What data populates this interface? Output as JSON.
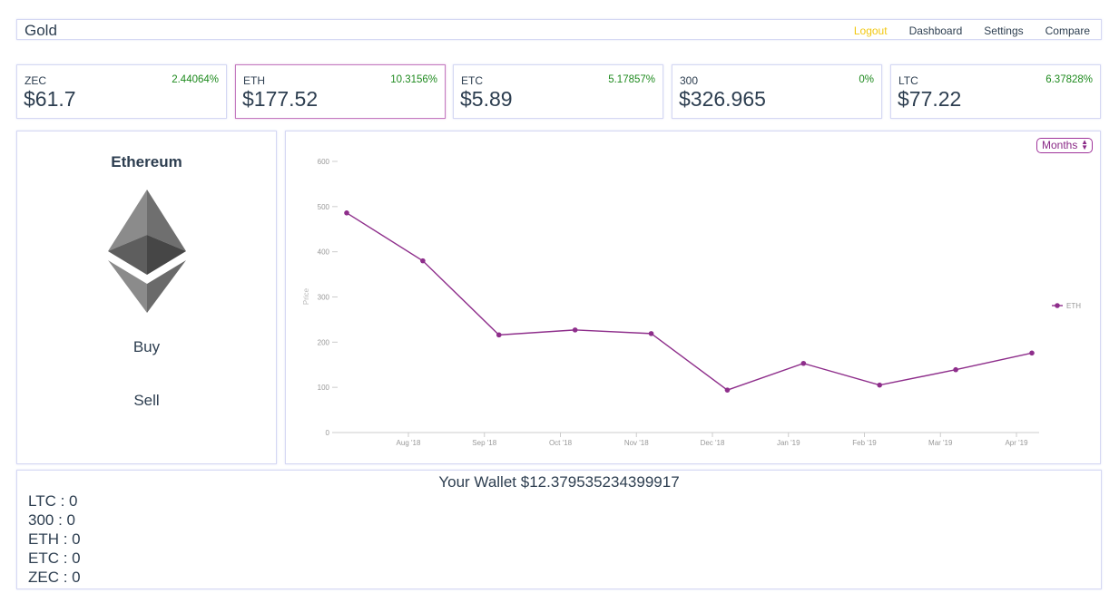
{
  "navbar": {
    "brand": "Gold",
    "links": [
      "Logout",
      "Dashboard",
      "Settings",
      "Compare"
    ]
  },
  "tickers": [
    {
      "symbol": "ZEC",
      "change": "2.44064%",
      "price": "$61.7"
    },
    {
      "symbol": "ETH",
      "change": "10.3156%",
      "price": "$177.52"
    },
    {
      "symbol": "ETC",
      "change": "5.17857%",
      "price": "$5.89"
    },
    {
      "symbol": "300",
      "change": "0%",
      "price": "$326.965"
    },
    {
      "symbol": "LTC",
      "change": "6.37828%",
      "price": "$77.22"
    }
  ],
  "coin_panel": {
    "name": "Ethereum",
    "buy_label": "Buy",
    "sell_label": "Sell",
    "logo_icon": "ethereum-logo-icon"
  },
  "range_select": {
    "selected": "Months"
  },
  "chart_data": {
    "type": "line",
    "ylabel": "Price",
    "ylim": [
      0,
      600
    ],
    "yticks": [
      0,
      100,
      200,
      300,
      400,
      500,
      600
    ],
    "xticks": [
      "Aug '18",
      "Sep '18",
      "Oct '18",
      "Nov '18",
      "Dec '18",
      "Jan '19",
      "Feb '19",
      "Mar '19",
      "Apr '19"
    ],
    "series": [
      {
        "name": "ETH",
        "color": "#8e2e8b",
        "values": [
          486,
          380,
          216,
          227,
          219,
          94,
          153,
          105,
          139,
          176
        ]
      }
    ]
  },
  "wallet": {
    "title": "Your Wallet $12.379535234399917",
    "holdings": [
      "LTC : 0",
      "300 : 0",
      "ETH : 0",
      "ETC : 0",
      "ZEC : 0"
    ]
  }
}
